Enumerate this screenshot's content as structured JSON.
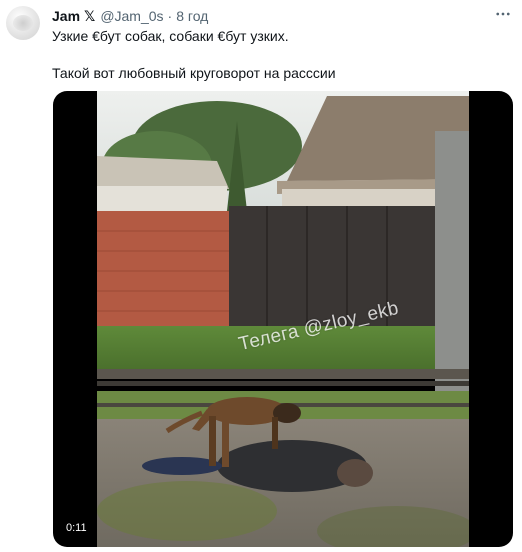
{
  "tweet": {
    "display_name": "Jam",
    "x_badge": "𝕏",
    "handle": "@Jam_0s",
    "separator": "·",
    "time": "8 год",
    "text_line_1": "Узкие €бут собак, собаки €бут узких.",
    "text_line_2": "Такой вот любовный круговорот на расссии",
    "more_icon": "ellipsis-icon"
  },
  "media": {
    "type": "video",
    "watermark": "Телега @zloy_ekb",
    "duration": "0:11",
    "background_color": "#000000"
  },
  "colors": {
    "text_primary": "#0f1419",
    "text_secondary": "#536471"
  }
}
